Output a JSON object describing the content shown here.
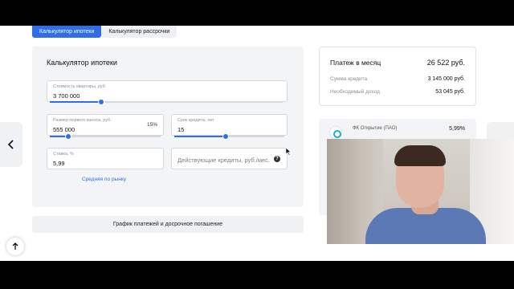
{
  "tabs": [
    {
      "label": "Калькулятор ипотеки"
    },
    {
      "label": "Калькулятор рассрочки"
    }
  ],
  "calculator": {
    "title": "Калькулятор ипотеки",
    "price": {
      "label": "Стоимость квартиры, руб.",
      "value": "3 700 000",
      "slider_fraction": 0.22
    },
    "down_payment": {
      "label": "Размер первого взноса, руб.",
      "value": "555 000",
      "percent": "15%",
      "slider_fraction": 0.17
    },
    "term": {
      "label": "Срок кредита, лет",
      "value": "15",
      "slider_fraction": 0.47
    },
    "rate": {
      "label": "Ставка, %",
      "value": "5,99"
    },
    "existing_loans": {
      "placeholder": "Действующие кредиты, руб./мес.",
      "help": "?"
    },
    "market_link": "Средняя по рынку"
  },
  "schedule_button": "График платежей и досрочное погашение",
  "summary": {
    "monthly_label": "Платеж в месяц",
    "monthly_value": "26 522 руб.",
    "loan_label": "Сумма кредита",
    "loan_value": "3 145 000 руб.",
    "income_label": "Необходимый доход",
    "income_value": "53 045 руб."
  },
  "offer": {
    "bank_name": "ФК Открытие (ПАО)",
    "rate": "5,99%"
  },
  "icons": {
    "prev": "chevron-left-icon",
    "scroll_top": "arrow-up-icon",
    "bank": "bank-logo-icon",
    "help": "help-icon"
  },
  "colors": {
    "accent": "#2f6ee8",
    "panel": "#f3f4f6"
  }
}
